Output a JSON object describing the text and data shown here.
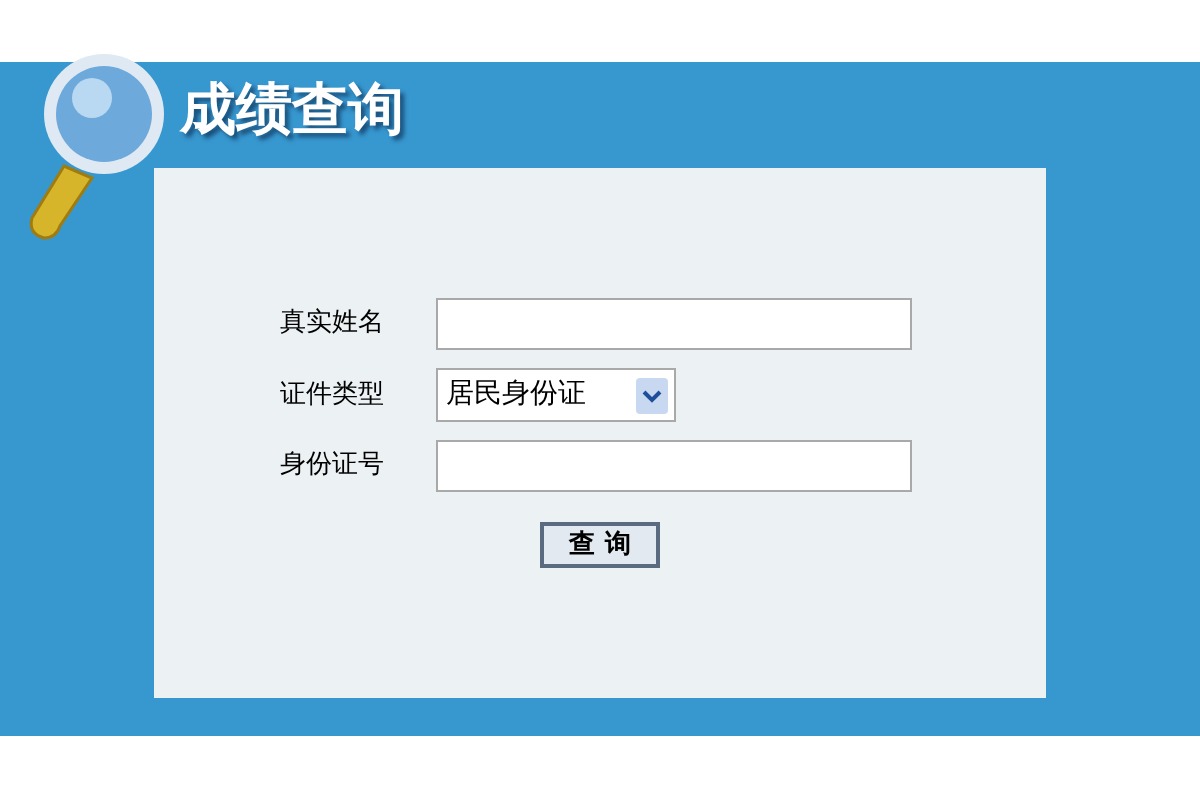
{
  "title": "成绩查询",
  "form": {
    "fields": [
      {
        "kind": "text",
        "label": "真实姓名"
      },
      {
        "kind": "select",
        "label": "证件类型",
        "value": "居民身份证"
      },
      {
        "kind": "text",
        "label": "身份证号"
      }
    ],
    "button": "查 询"
  }
}
